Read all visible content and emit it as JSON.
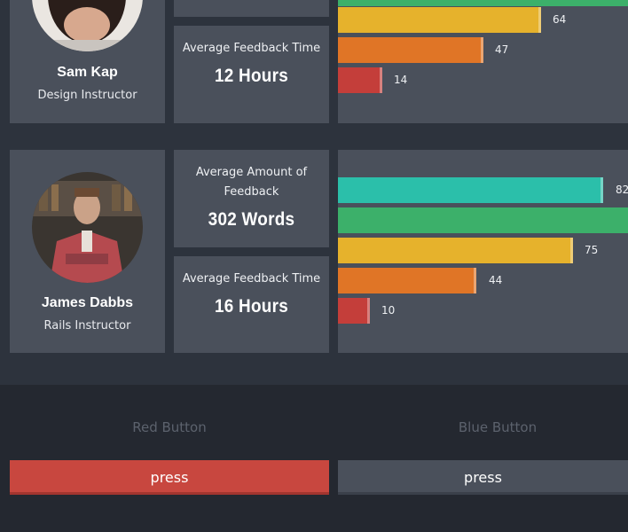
{
  "instructors": [
    {
      "name": "Sam Kap",
      "role": "Design Instructor",
      "feedback_time_label": "Average Feedback Time",
      "feedback_time_value": "12 Hours",
      "bars": [
        {
          "value": null,
          "color": "#3cb06a"
        },
        {
          "value": 64,
          "color": "#e6b22c"
        },
        {
          "value": 47,
          "color": "#e07526"
        },
        {
          "value": 14,
          "color": "#c43e3a"
        }
      ]
    },
    {
      "name": "James Dabbs",
      "role": "Rails Instructor",
      "feedback_amount_label": "Average Amount of Feedback",
      "feedback_amount_value": "302 Words",
      "feedback_time_label": "Average Feedback Time",
      "feedback_time_value": "16 Hours",
      "bars": [
        {
          "value": 82,
          "color": "#2bbfaa"
        },
        {
          "value": null,
          "color": "#3cb06a"
        },
        {
          "value": 75,
          "color": "#e6b22c"
        },
        {
          "value": 44,
          "color": "#e07526"
        },
        {
          "value": 10,
          "color": "#c43e3a"
        }
      ]
    }
  ],
  "labels": {
    "bar1_64": "64",
    "bar1_47": "47",
    "bar1_14": "14",
    "bar2_82": "82",
    "bar2_75": "75",
    "bar2_44": "44",
    "bar2_10": "10"
  },
  "buttons": {
    "red": {
      "title": "Red Button",
      "label": "press",
      "color": "#c8473f"
    },
    "blue": {
      "title": "Blue Button",
      "label": "press",
      "color": "#4a505b"
    }
  }
}
